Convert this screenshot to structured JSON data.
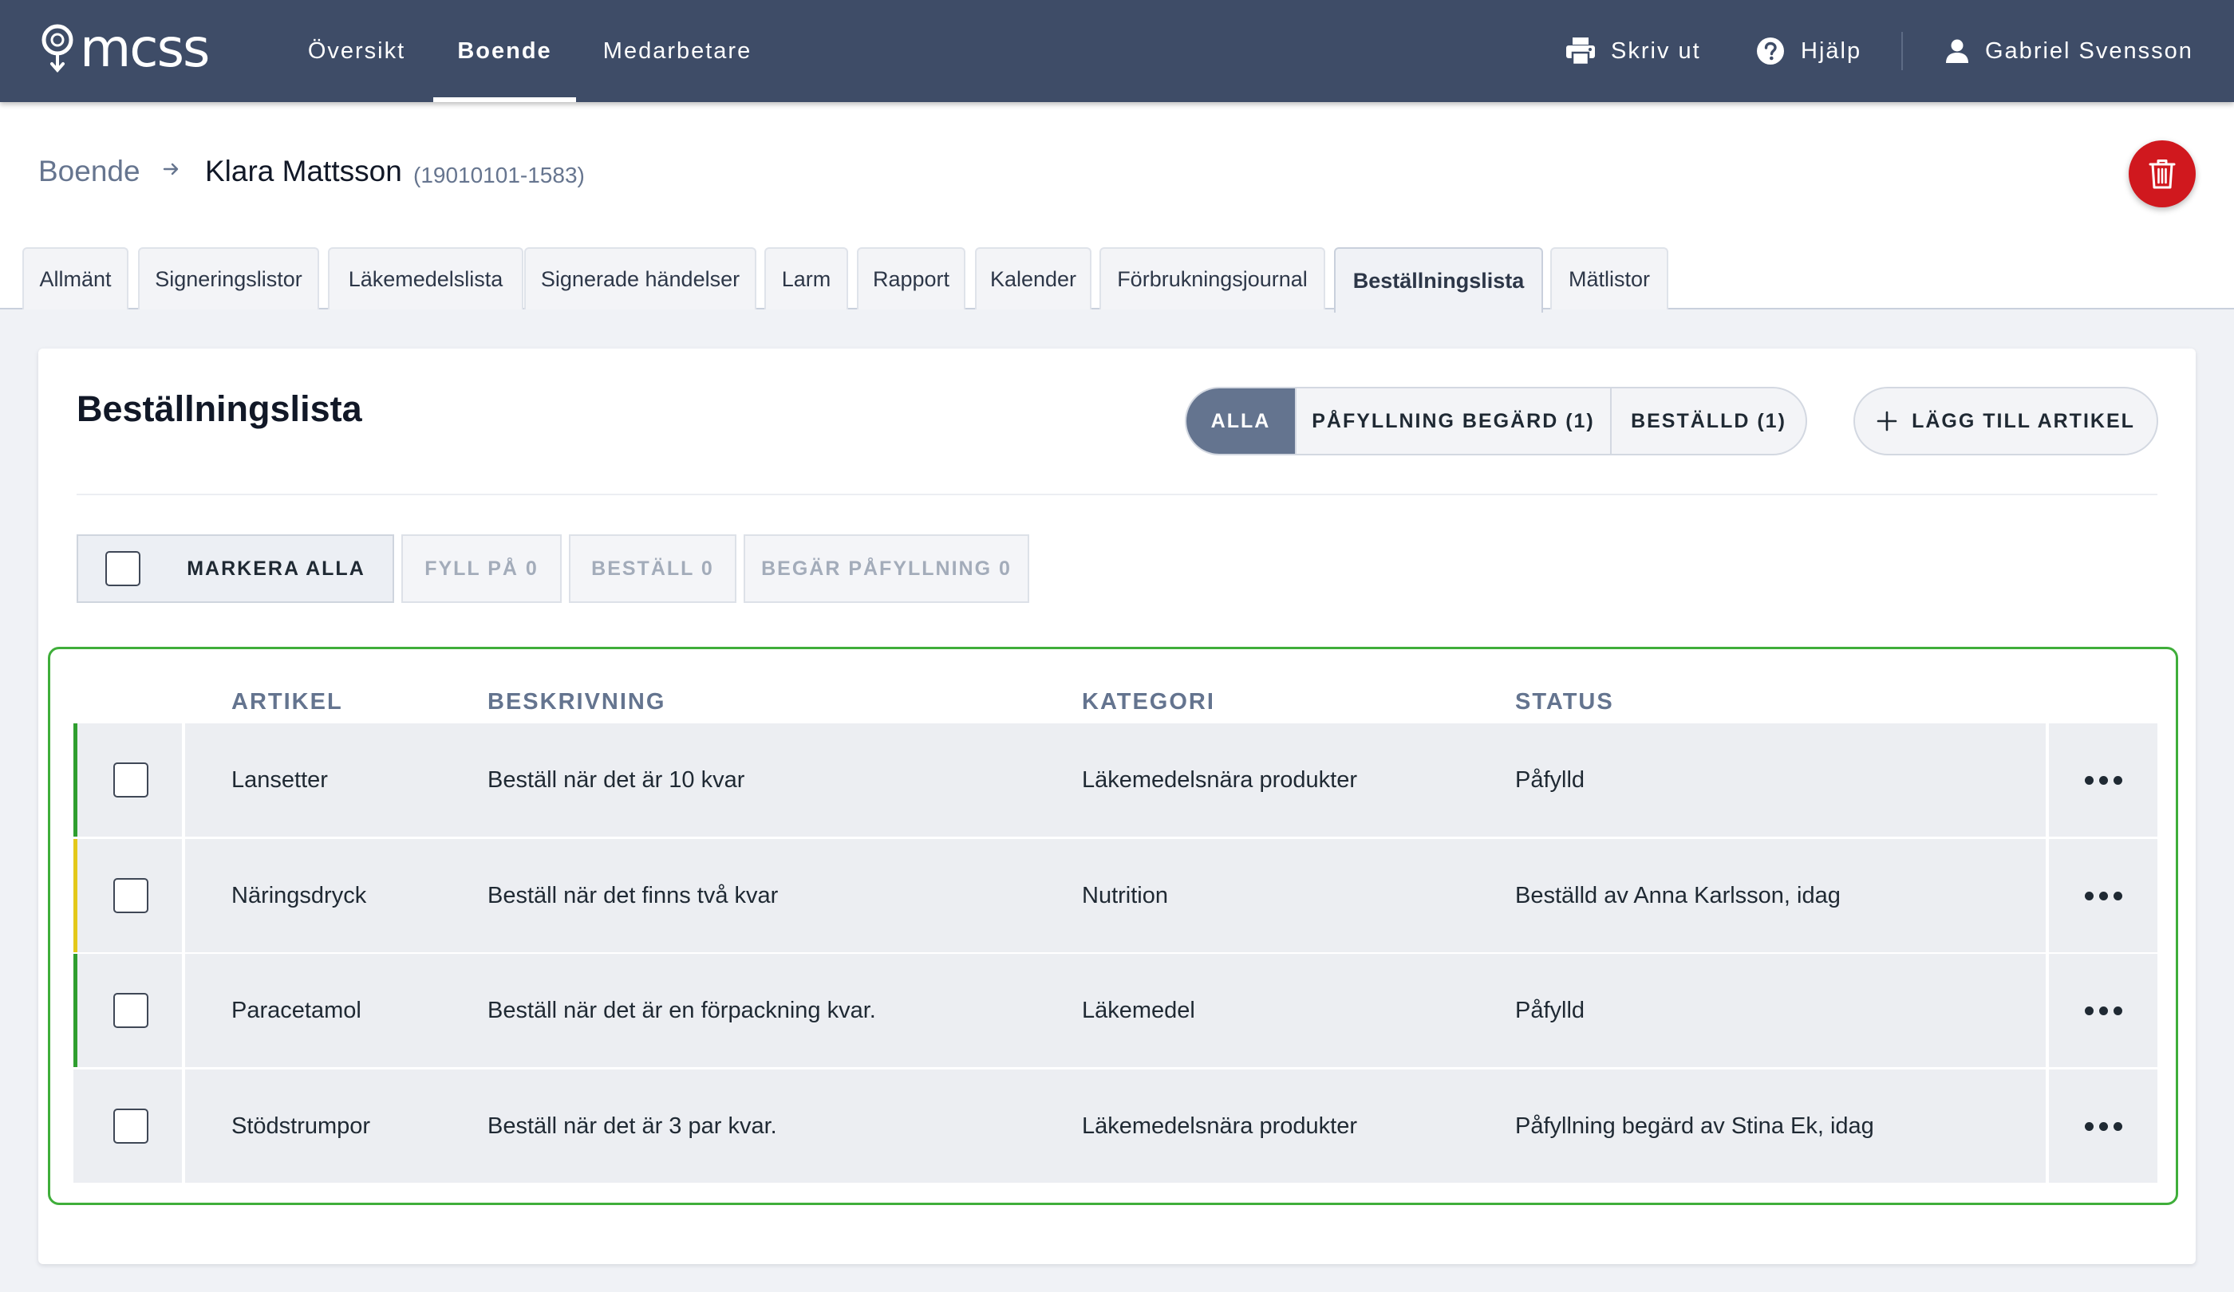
{
  "app": {
    "logo_text": "mcss",
    "nav": [
      {
        "label": "Översikt",
        "active": false
      },
      {
        "label": "Boende",
        "active": true
      },
      {
        "label": "Medarbetare",
        "active": false
      }
    ],
    "print_label": "Skriv ut",
    "help_label": "Hjälp",
    "user_name": "Gabriel Svensson"
  },
  "breadcrumb": {
    "root": "Boende",
    "resident_name": "Klara Mattsson",
    "personal_number": "(19010101-1583)"
  },
  "tabs": [
    {
      "label": "Allmänt",
      "active": false
    },
    {
      "label": "Signeringslistor",
      "active": false
    },
    {
      "label": "Läkemedelslista",
      "active": false
    },
    {
      "label": "Signerade händelser",
      "active": false
    },
    {
      "label": "Larm",
      "active": false
    },
    {
      "label": "Rapport",
      "active": false
    },
    {
      "label": "Kalender",
      "active": false
    },
    {
      "label": "Förbrukningsjournal",
      "active": false
    },
    {
      "label": "Beställningslista",
      "active": true
    },
    {
      "label": "Mätlistor",
      "active": false
    }
  ],
  "page": {
    "title": "Beställningslista",
    "filters": [
      {
        "label": "ALLA",
        "active": true
      },
      {
        "label": "PÅFYLLNING BEGÄRD (1)",
        "active": false
      },
      {
        "label": "BESTÄLLD (1)",
        "active": false
      }
    ],
    "add_article_label": "LÄGG TILL ARTIKEL",
    "bulk": {
      "select_all": "MARKERA ALLA",
      "fill": "FYLL PÅ 0",
      "order": "BESTÄLL 0",
      "request_refill": "BEGÄR PÅFYLLNING 0"
    }
  },
  "table": {
    "columns": [
      "ARTIKEL",
      "BESKRIVNING",
      "KATEGORI",
      "STATUS"
    ],
    "rows": [
      {
        "article": "Lansetter",
        "description": "Beställ när det är 10 kvar",
        "category": "Läkemedelsnära produkter",
        "status": "Påfylld",
        "indicator_color": "#2f9e2f"
      },
      {
        "article": "Näringsdryck",
        "description": "Beställ när det finns två kvar",
        "category": "Nutrition",
        "status": "Beställd av Anna Karlsson, idag",
        "indicator_color": "#e3c81a"
      },
      {
        "article": "Paracetamol",
        "description": "Beställ när det är en förpackning kvar.",
        "category": "Läkemedel",
        "status": "Påfylld",
        "indicator_color": "#2f9e2f"
      },
      {
        "article": "Stödstrumpor",
        "description": "Beställ när det är 3 par kvar.",
        "category": "Läkemedelsnära produkter",
        "status": "Påfyllning begärd av Stina Ek, idag",
        "indicator_color": ""
      }
    ]
  },
  "colors": {
    "topbar": "#3e4c67",
    "accent_active_filter": "#64748f",
    "delete": "#d0181e",
    "table_highlight": "#3fae3a"
  },
  "icons": {
    "logo": "mcss-logo-icon",
    "print": "printer-icon",
    "help": "question-circle-icon",
    "user": "user-icon",
    "arrow": "arrow-right-icon",
    "delete": "trash-icon",
    "add": "plus-icon",
    "row_menu": "more-horizontal-icon"
  }
}
